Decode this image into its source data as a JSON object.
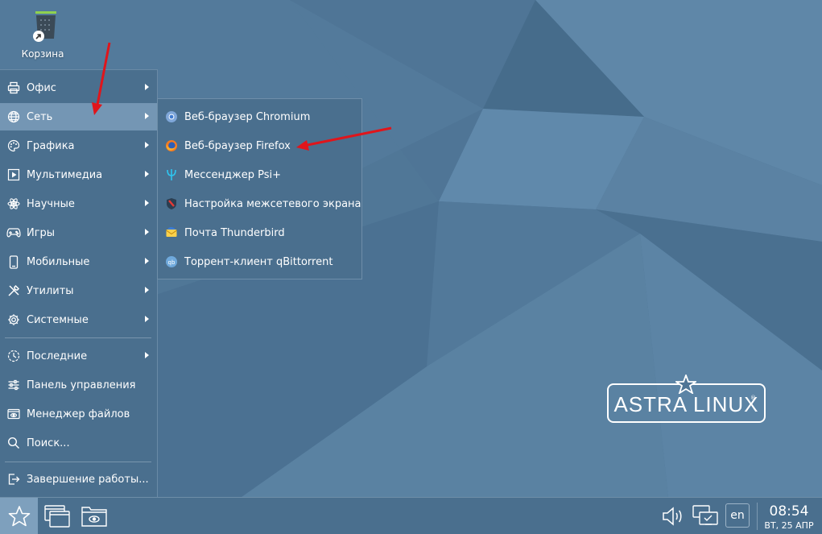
{
  "desktop": {
    "trash_label": "Корзина",
    "logo_text": "ASTRA LINUX",
    "logo_reg": "®"
  },
  "start_menu": {
    "items": [
      {
        "label": "Офис",
        "icon": "printer-icon",
        "submenu": true
      },
      {
        "label": "Сеть",
        "icon": "globe-icon",
        "submenu": true,
        "active": true
      },
      {
        "label": "Графика",
        "icon": "palette-icon",
        "submenu": true
      },
      {
        "label": "Мультимедиа",
        "icon": "play-icon",
        "submenu": true
      },
      {
        "label": "Научные",
        "icon": "atom-icon",
        "submenu": true
      },
      {
        "label": "Игры",
        "icon": "gamepad-icon",
        "submenu": true
      },
      {
        "label": "Мобильные",
        "icon": "phone-icon",
        "submenu": true
      },
      {
        "label": "Утилиты",
        "icon": "tools-icon",
        "submenu": true
      },
      {
        "label": "Системные",
        "icon": "gear-icon",
        "submenu": true
      },
      {
        "label": "Последние",
        "icon": "recent-clock-icon",
        "submenu": true
      },
      {
        "label": "Панель управления",
        "icon": "sliders-icon",
        "submenu": false
      },
      {
        "label": "Менеджер файлов",
        "icon": "file-manager-icon",
        "submenu": false
      },
      {
        "label": "Поиск...",
        "icon": "search-icon",
        "submenu": false
      },
      {
        "label": "Завершение работы...",
        "icon": "logout-icon",
        "submenu": false
      }
    ]
  },
  "network_submenu": {
    "items": [
      {
        "label": "Веб-браузер Chromium",
        "icon": "chromium-icon"
      },
      {
        "label": "Веб-браузер Firefox",
        "icon": "firefox-icon"
      },
      {
        "label": "Мессенджер Psi+",
        "icon": "psi-icon"
      },
      {
        "label": "Настройка межсетевого экрана",
        "icon": "firewall-shield-icon"
      },
      {
        "label": "Почта Thunderbird",
        "icon": "thunderbird-icon"
      },
      {
        "label": "Торрент-клиент qBittorrent",
        "icon": "qbittorrent-icon"
      }
    ]
  },
  "taskbar": {
    "language": "en",
    "time": "08:54",
    "date": "ВТ, 25 АПР"
  },
  "colors": {
    "accent": "#7496b4",
    "panel": "#4a6f8e",
    "annotation_arrow": "#e0151b"
  }
}
